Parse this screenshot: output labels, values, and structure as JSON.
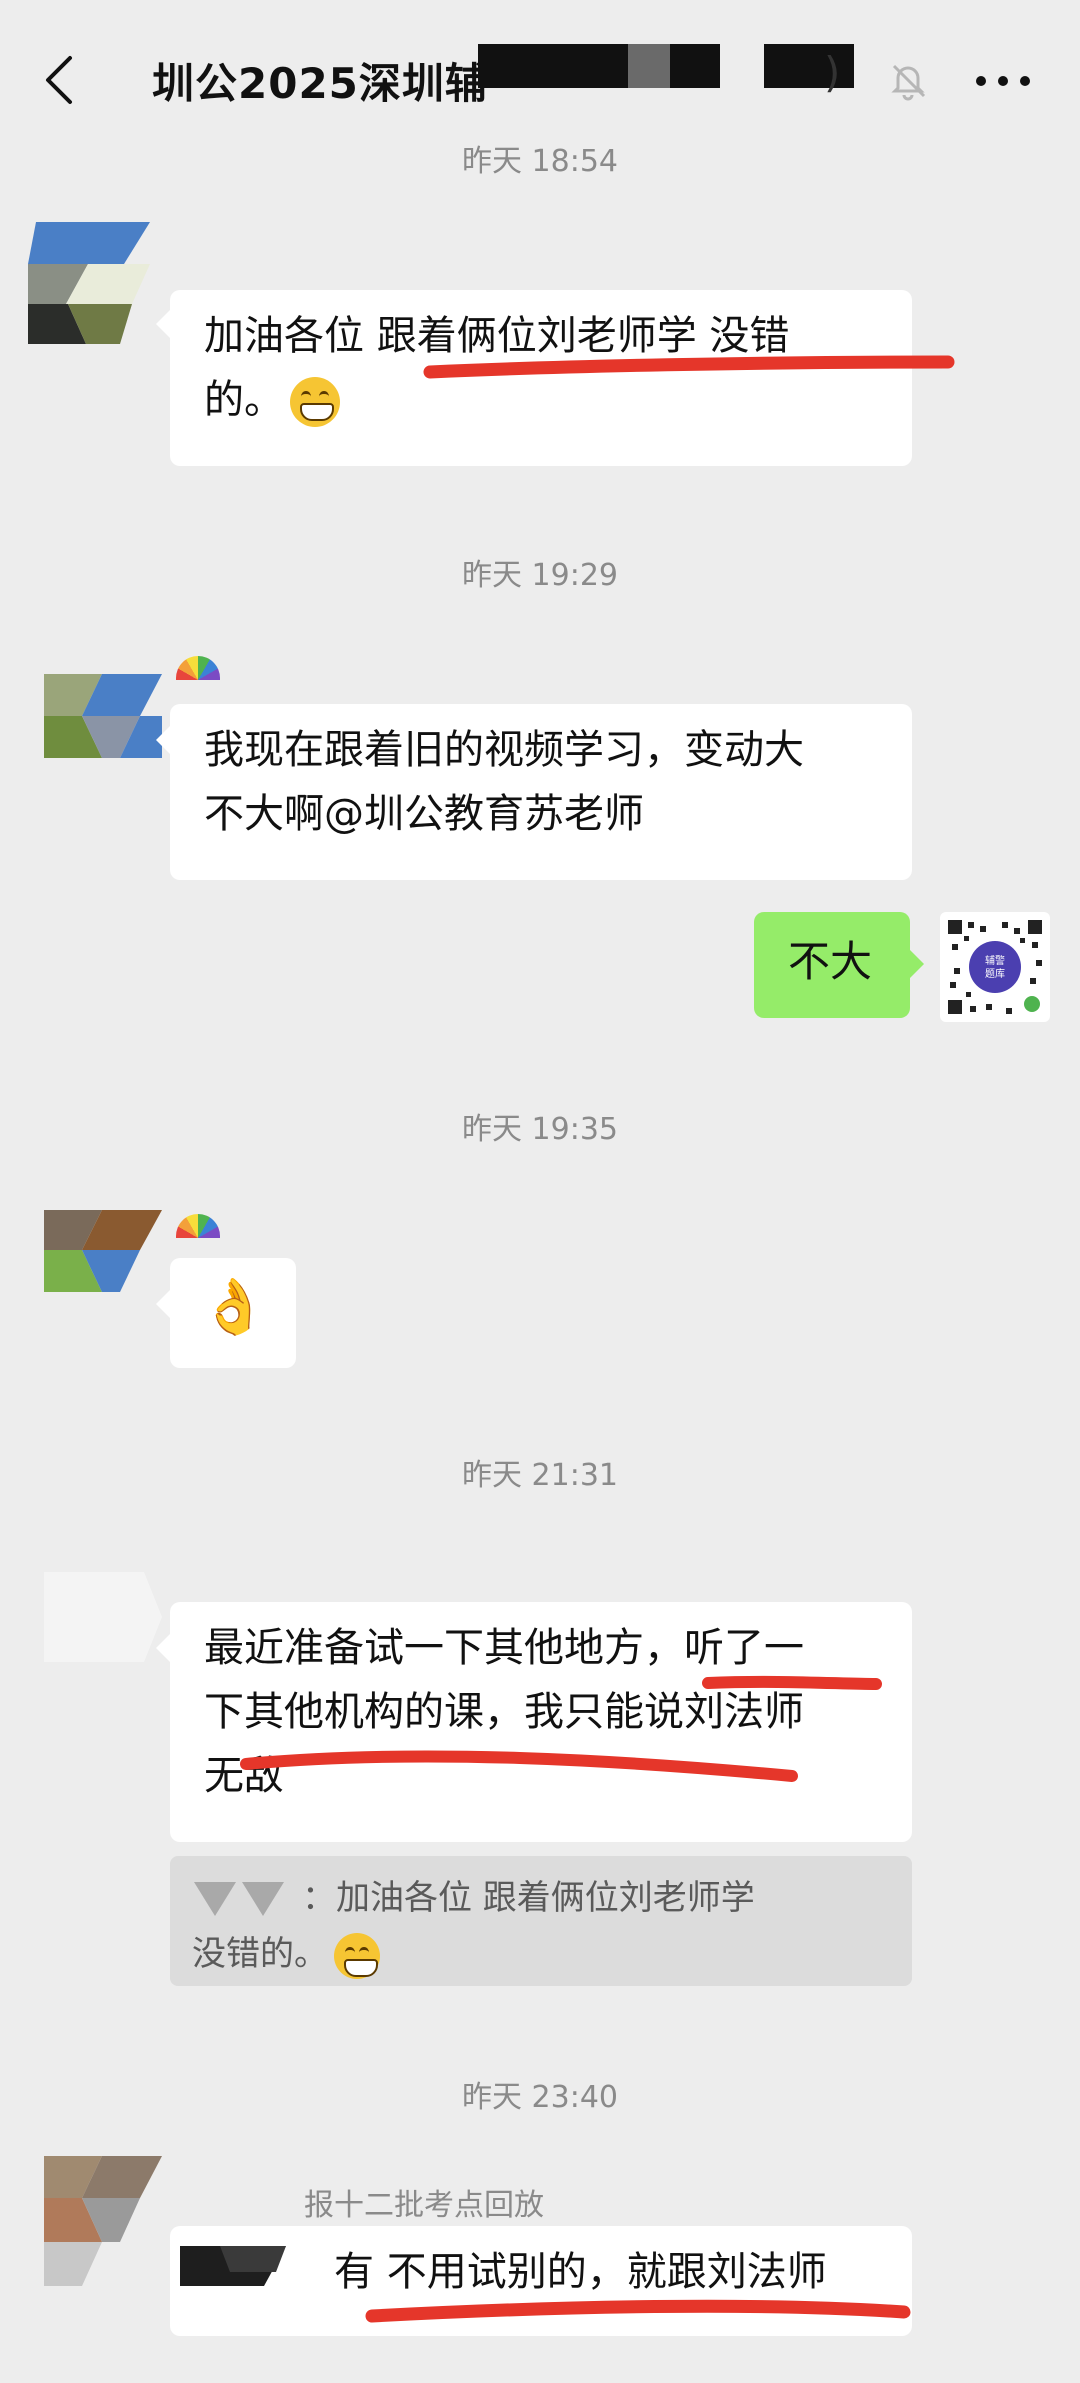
{
  "header": {
    "title": "圳公2025深圳辅",
    "title_tail": ")",
    "back_icon": "chevron-left-icon",
    "mute_icon": "bell-off-icon",
    "more_icon": "more-horizontal-icon"
  },
  "messages": {
    "ts0": "昨天 18:54",
    "m1": {
      "line1": "加油各位 跟着俩位刘老师学 没错",
      "line2": "的。"
    },
    "ts1": "昨天 19:29",
    "m2": {
      "line1": "我现在跟着旧的视频学习，变动大",
      "line2": "不大啊@圳公教育苏老师"
    },
    "m3": {
      "text": "不大"
    },
    "ts2": "昨天 19:35",
    "m4": {
      "emoji": "👌"
    },
    "ts3": "昨天 21:31",
    "m5": {
      "line1": "最近准备试一下其他地方，听了一",
      "line2": "下其他机构的课，我只能说刘法师",
      "line3": "无敌"
    },
    "quote": {
      "line1": "：加油各位 跟着俩位刘老师学",
      "line2": "没错的。"
    },
    "ts4": "昨天 23:40",
    "nick5": "报十二批考点回放",
    "m6": {
      "text": "有  不用试别的，就跟刘法师"
    }
  },
  "qr_avatar": {
    "line1": "辅警",
    "line2": "题库"
  },
  "colors": {
    "background": "#ededed",
    "bubble_other": "#ffffff",
    "bubble_me": "#95ec69",
    "underline": "#e5362a"
  }
}
